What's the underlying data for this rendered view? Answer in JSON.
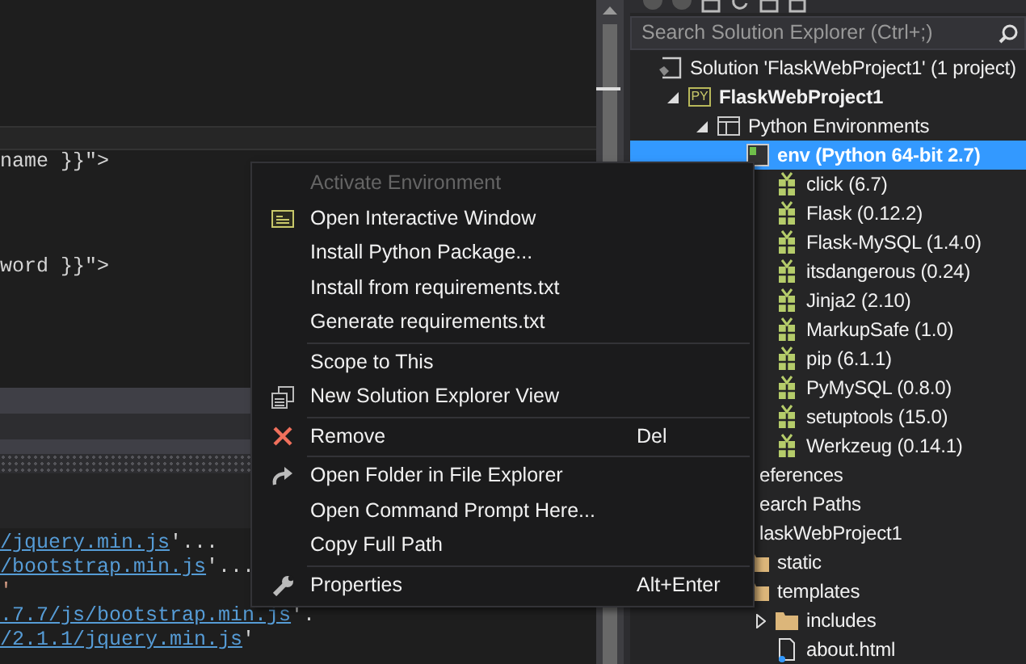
{
  "editor": {
    "code_lines": [
      "name }}\">",
      "word }}\">"
    ]
  },
  "output": {
    "lines": [
      {
        "kind": "link",
        "link": "/jquery.min.js",
        "text": "'..."
      },
      {
        "kind": "link",
        "link": "/bootstrap.min.js",
        "text": "'..."
      },
      {
        "kind": "string",
        "text": "'"
      },
      {
        "kind": "link",
        "link": ".7.7/js/bootstrap.min.js",
        "text": "'."
      },
      {
        "kind": "link",
        "link": "/2.1.1/jquery.min.js",
        "text": "'"
      }
    ]
  },
  "solution_explorer": {
    "search": {
      "placeholder": "Search Solution Explorer (Ctrl+;)"
    },
    "tree": [
      {
        "label": "Solution 'FlaskWebProject1' (1 project)",
        "kind": "solution",
        "selected": false,
        "children": [
          {
            "label": "FlaskWebProject1",
            "kind": "project",
            "badge": "PY",
            "expanded": true,
            "selected": false,
            "children": [
              {
                "label": "Python Environments",
                "kind": "environments",
                "expanded": true,
                "selected": false,
                "children": [
                  {
                    "label": "env (Python 64-bit 2.7)",
                    "kind": "env",
                    "selected": true,
                    "children": [
                      {
                        "label": "click (6.7)",
                        "kind": "package",
                        "selected": false
                      },
                      {
                        "label": "Flask (0.12.2)",
                        "kind": "package",
                        "selected": false
                      },
                      {
                        "label": "Flask-MySQL (1.4.0)",
                        "kind": "package",
                        "selected": false
                      },
                      {
                        "label": "itsdangerous (0.24)",
                        "kind": "package",
                        "selected": false
                      },
                      {
                        "label": "Jinja2 (2.10)",
                        "kind": "package",
                        "selected": false
                      },
                      {
                        "label": "MarkupSafe (1.0)",
                        "kind": "package",
                        "selected": false
                      },
                      {
                        "label": "pip (6.1.1)",
                        "kind": "package",
                        "selected": false
                      },
                      {
                        "label": "PyMySQL (0.8.0)",
                        "kind": "package",
                        "selected": false
                      },
                      {
                        "label": "setuptools (15.0)",
                        "kind": "package",
                        "selected": false
                      },
                      {
                        "label": "Werkzeug (0.14.1)",
                        "kind": "package",
                        "selected": false
                      }
                    ]
                  }
                ]
              },
              {
                "label": "eferences",
                "kind": "hidden",
                "selected": false
              },
              {
                "label": "earch Paths",
                "kind": "hidden",
                "selected": false
              },
              {
                "label": "laskWebProject1",
                "kind": "hidden",
                "selected": false,
                "children": [
                  {
                    "label": "static",
                    "kind": "folder",
                    "selected": false
                  },
                  {
                    "label": "templates",
                    "kind": "folder",
                    "selected": false,
                    "children": [
                      {
                        "label": "includes",
                        "kind": "folder",
                        "expanded": false,
                        "selected": false
                      },
                      {
                        "label": "about.html",
                        "kind": "file",
                        "selected": false
                      }
                    ]
                  }
                ]
              }
            ]
          }
        ]
      }
    ]
  },
  "context_menu": {
    "groups": [
      [
        {
          "label": "Activate Environment",
          "kind": "plain",
          "disabled": true
        },
        {
          "label": "Open Interactive Window",
          "kind": "window",
          "disabled": false
        },
        {
          "label": "Install Python Package...",
          "kind": "plain",
          "disabled": false
        },
        {
          "label": "Install from requirements.txt",
          "kind": "plain",
          "disabled": false
        },
        {
          "label": "Generate requirements.txt",
          "kind": "plain",
          "disabled": false
        }
      ],
      [
        {
          "label": "Scope to This",
          "kind": "plain",
          "disabled": false
        },
        {
          "label": "New Solution Explorer View",
          "kind": "view",
          "disabled": false
        }
      ],
      [
        {
          "label": "Remove",
          "kind": "remove",
          "disabled": false,
          "shortcut": "Del"
        }
      ],
      [
        {
          "label": "Open Folder in File Explorer",
          "kind": "folder",
          "disabled": false
        },
        {
          "label": "Open Command Prompt Here...",
          "kind": "plain",
          "disabled": false
        },
        {
          "label": "Copy Full Path",
          "kind": "plain",
          "disabled": false
        }
      ],
      [
        {
          "label": "Properties",
          "kind": "properties",
          "disabled": false,
          "shortcut": "Alt+Enter"
        }
      ]
    ]
  }
}
